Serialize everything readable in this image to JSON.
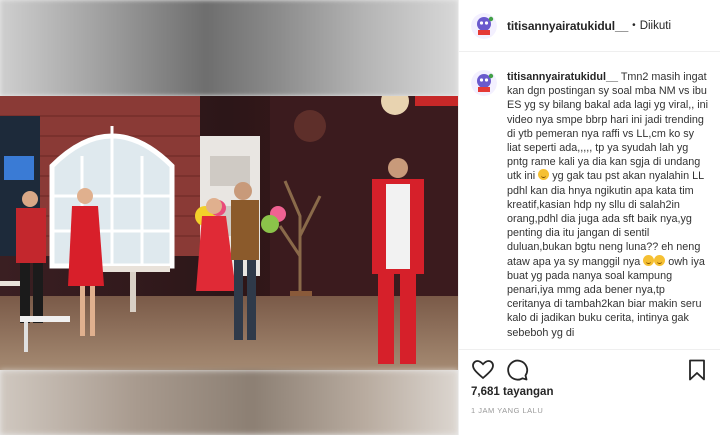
{
  "post": {
    "username": "titisannyairatukidul__",
    "separator": "•",
    "follow_label": "Diikuti"
  },
  "caption": {
    "username": "titisannyairatukidul__",
    "text_1": "Tmn2 masih ingat kan dgn postingan sy soal mba NM vs ibu ES yg sy bilang bakal ada lagi yg viral,, ini video nya smpe bbrp hari ini jadi trending di ytb pemeran nya raffi vs LL,cm ko sy liat seperti ada,,,,, tp ya syudah lah yg pntg rame kali ya dia kan sgja di undang utk ini",
    "text_2": "yg gak tau pst akan nyalahin LL pdhl kan dia hnya ngikutin apa kata tim kreatif,kasian hdp ny sllu di salah2in orang,pdhl dia juga ada sft baik nya,yg penting dia itu jangan di sentil duluan,bukan bgtu neng luna?? eh neng ataw apa ya sy manggil nya",
    "text_3": "owh iya buat yg pada nanya soal kampung penari,iya mmg ada bener nya,tp ceritanya di tambah2kan biar makin seru kalo di jadikan buku cerita, intinya gak sebeboh yg di"
  },
  "stats": {
    "views_count": "7,681",
    "views_label": "tayangan",
    "time_ago": "1 JAM YANG LALU"
  },
  "icons": {
    "like": "heart-icon",
    "comment": "comment-icon",
    "save": "bookmark-icon"
  },
  "colors": {
    "text": "#262626",
    "muted": "#999999",
    "border": "#efefef"
  }
}
